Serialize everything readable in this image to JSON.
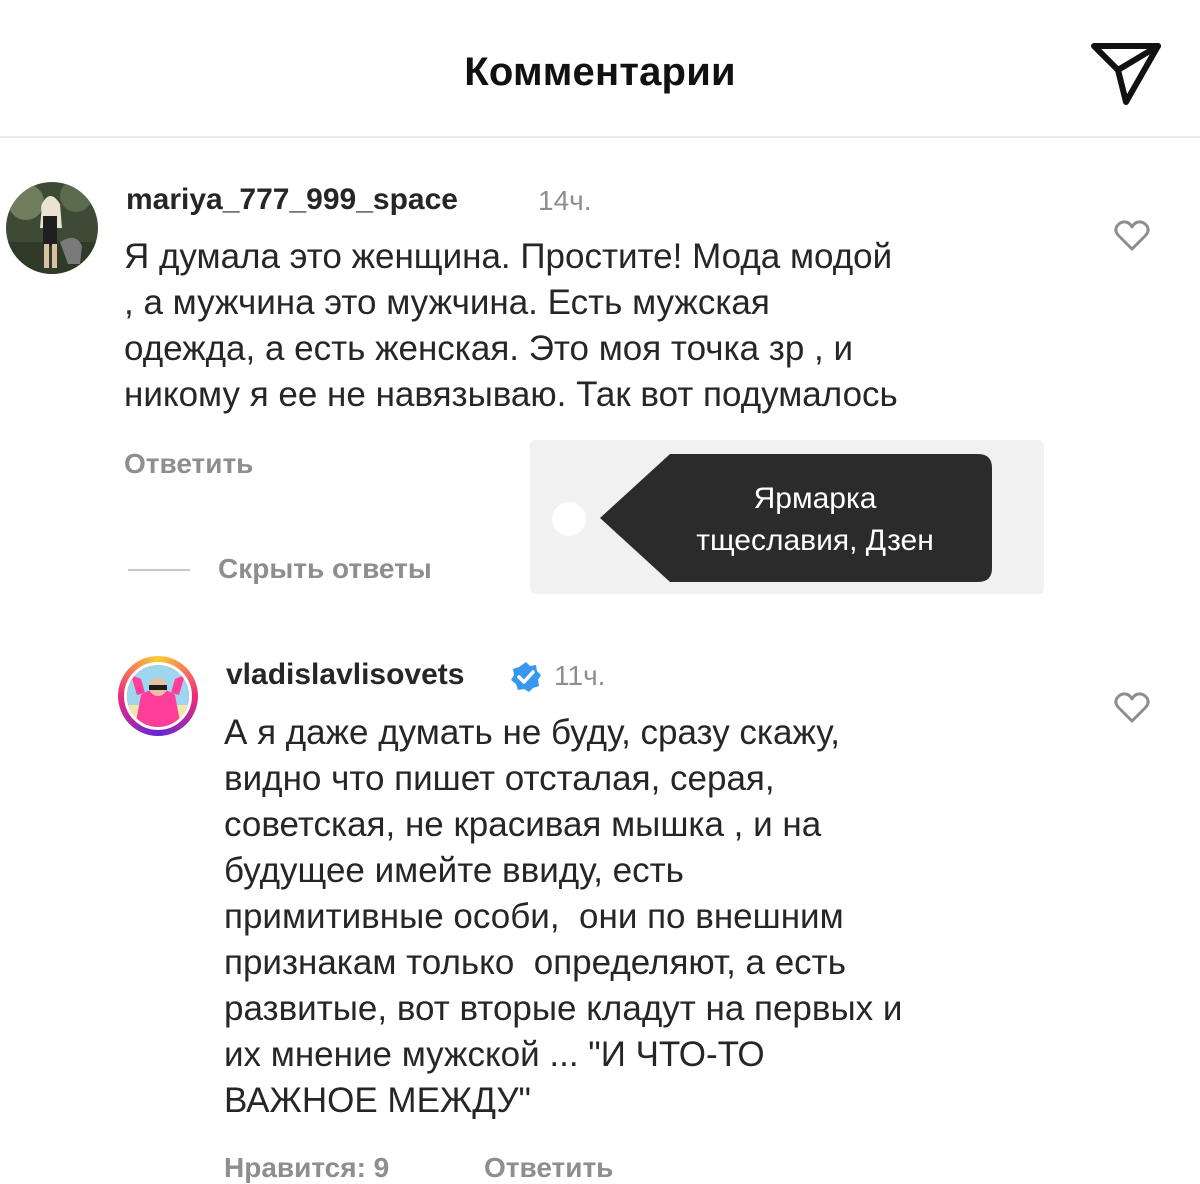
{
  "header": {
    "title": "Комментарии",
    "send_icon": "paper-plane-icon"
  },
  "comments": [
    {
      "username": "mariya_777_999_space",
      "time": "14ч.",
      "verified": false,
      "lines": [
        "Я думала это женщина. Простите! Мода модой",
        ", а мужчина это мужчина. Есть мужская",
        "одежда, а есть женская. Это моя точка зр , и",
        "никому я ее не навязываю. Так вот подумалось"
      ],
      "reply_label": "Ответить",
      "hide_replies_label": "Скрыть ответы"
    },
    {
      "username": "vladislavlisovets",
      "time": "11ч.",
      "verified": true,
      "lines": [
        "А я даже думать не буду, сразу скажу,",
        "видно что пишет отсталая, серая,",
        "советская, не красивая мышка , и на",
        "будущее имейте ввиду, есть",
        "примитивные особи,  они по внешним",
        "признакам только  определяют, а есть",
        "развитые, вот вторые кладут на первых и",
        "их мнение мужской ... \"И ЧТО-ТО",
        "ВАЖНОЕ МЕЖДУ\""
      ],
      "likes_label": "Нравится: 9",
      "reply_label": "Ответить"
    }
  ],
  "watermark": {
    "lines": [
      "Ярмарка",
      "тщеславия, Дзен"
    ],
    "background": "#2b2b2b"
  },
  "colors": {
    "text": "#262626",
    "secondary": "#8e8e8e",
    "verified": "#3897f0"
  }
}
